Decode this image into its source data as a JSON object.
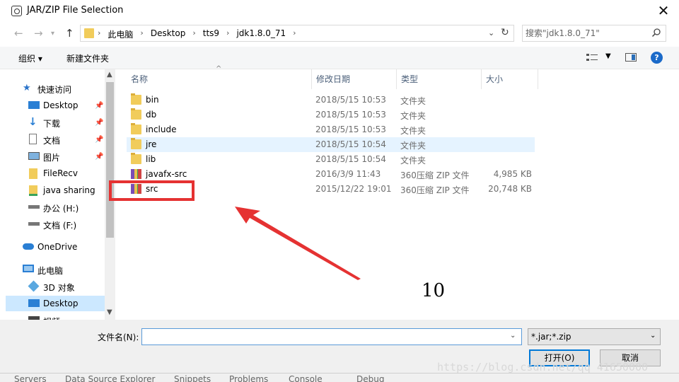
{
  "window": {
    "title": "JAR/ZIP File Selection",
    "close_glyph": "✕"
  },
  "address": {
    "crumbs": [
      "此电脑",
      "Desktop",
      "tts9",
      "jdk1.8.0_71"
    ],
    "search_placeholder": "搜索\"jdk1.8.0_71\""
  },
  "toolbar": {
    "organize": "组织 ▾",
    "new_folder": "新建文件夹",
    "help": "?"
  },
  "nav": [
    {
      "label": "快速访问",
      "icon": "star-icon"
    },
    {
      "label": "Desktop",
      "icon": "desktop-icon",
      "pinned": true
    },
    {
      "label": "下载",
      "icon": "download-icon",
      "pinned": true
    },
    {
      "label": "文档",
      "icon": "document-icon",
      "pinned": true
    },
    {
      "label": "图片",
      "icon": "picture-icon",
      "pinned": true
    },
    {
      "label": "FileRecv",
      "icon": "folder-icon"
    },
    {
      "label": "java sharing",
      "icon": "folder-icon"
    },
    {
      "label": "办公 (H:)",
      "icon": "drive-icon"
    },
    {
      "label": "文档 (F:)",
      "icon": "drive-icon"
    },
    {
      "label": "OneDrive",
      "icon": "cloud-icon"
    },
    {
      "label": "此电脑",
      "icon": "computer-icon"
    },
    {
      "label": "3D 对象",
      "icon": "cube-icon"
    },
    {
      "label": "Desktop",
      "icon": "desktop-icon",
      "selected": true
    },
    {
      "label": "视频",
      "icon": "video-icon"
    }
  ],
  "columns": {
    "name": "名称",
    "date": "修改日期",
    "type": "类型",
    "size": "大小"
  },
  "files": [
    {
      "name": "bin",
      "date": "2018/5/15 10:53",
      "type": "文件夹",
      "size": "",
      "kind": "folder"
    },
    {
      "name": "db",
      "date": "2018/5/15 10:53",
      "type": "文件夹",
      "size": "",
      "kind": "folder"
    },
    {
      "name": "include",
      "date": "2018/5/15 10:53",
      "type": "文件夹",
      "size": "",
      "kind": "folder"
    },
    {
      "name": "jre",
      "date": "2018/5/15 10:54",
      "type": "文件夹",
      "size": "",
      "kind": "folder",
      "hover": true
    },
    {
      "name": "lib",
      "date": "2018/5/15 10:54",
      "type": "文件夹",
      "size": "",
      "kind": "folder"
    },
    {
      "name": "javafx-src",
      "date": "2016/3/9 11:43",
      "type": "360压缩 ZIP 文件",
      "size": "4,985 KB",
      "kind": "zip"
    },
    {
      "name": "src",
      "date": "2015/12/22 19:01",
      "type": "360压缩 ZIP 文件",
      "size": "20,748 KB",
      "kind": "zip"
    }
  ],
  "annotation": {
    "number": "10"
  },
  "bottom": {
    "filename_label": "文件名(N):",
    "filename_value": "",
    "filter": "*.jar;*.zip",
    "open": "打开(O)",
    "cancel": "取消"
  },
  "taskbar": [
    "Servers",
    "Data Source Explorer",
    "Snippets",
    "Problems",
    "Console",
    "Debug"
  ],
  "watermark": "https://blog.csdn.net/qq_41650000"
}
